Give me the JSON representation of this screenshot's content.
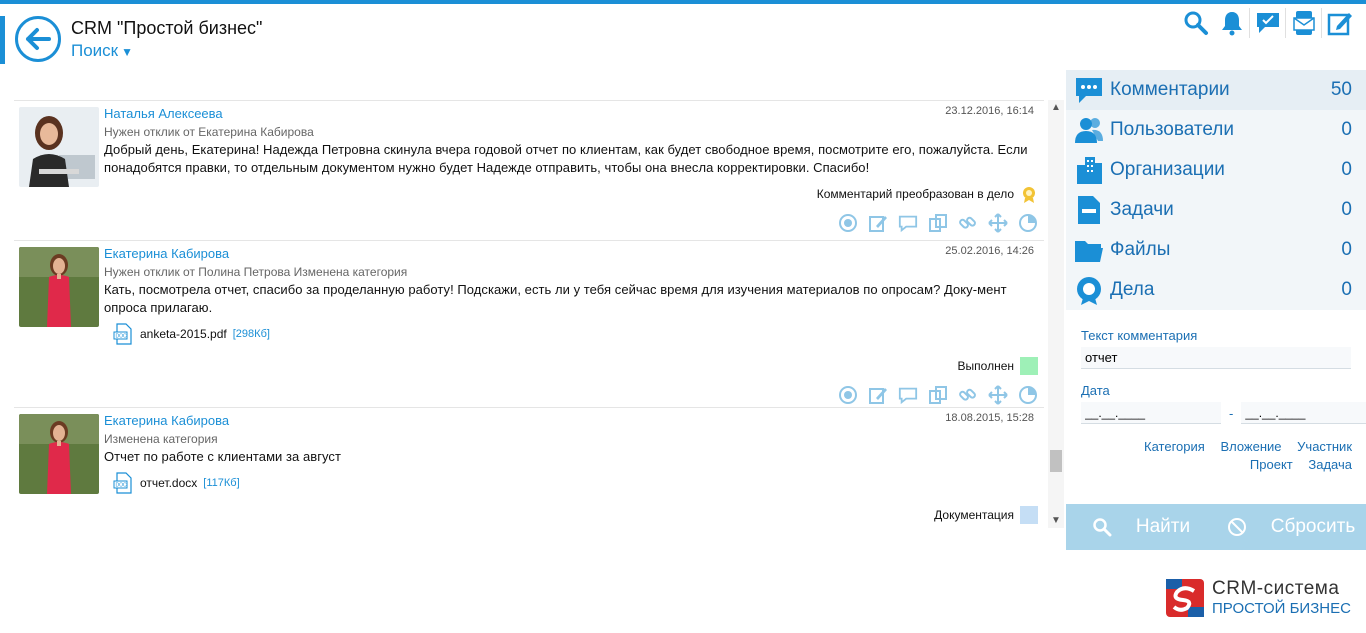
{
  "header": {
    "title": "CRM \"Простой бизнес\"",
    "search_label": "Поиск",
    "toolbar": [
      "search-icon",
      "bell-icon",
      "chat-icon",
      "envelope-phone-icon",
      "edit-icon"
    ]
  },
  "posts": [
    {
      "author": "Наталья Алексеева",
      "date": "23.12.2016, 16:14",
      "sub": "Нужен отклик от Екатерина Кабирова",
      "text": "Добрый день, Екатерина! Надежда Петровна скинула вчера годовой отчет по клиентам, как будет свободное время, посмотрите его, пожалуйста. Если понадобятся правки, то отдельным документом нужно будет Надежде отправить, чтобы она внесла корректировки. Спасибо!",
      "status": "Комментарий преобразован в дело"
    },
    {
      "author": "Екатерина Кабирова",
      "date": "25.02.2016, 14:26",
      "sub": "Нужен отклик от Полина Петрова Изменена категория",
      "text": "Кать, посмотрела отчет, спасибо за проделанную работу! Подскажи, есть ли у тебя сейчас время для изучения материалов по опросам? Доку-мент опроса прилагаю.",
      "file": "anketa-2015.pdf",
      "filesize": "[298Кб]",
      "status": "Выполнен",
      "status_color": "#9ef0b7"
    },
    {
      "author": "Екатерина Кабирова",
      "date": "18.08.2015, 15:28",
      "sub": "Изменена категория",
      "text": "Отчет по работе с клиентами за август",
      "file": "отчет.docx",
      "filesize": "[117Кб]",
      "status": "Документация",
      "status_color": "#c5def5"
    }
  ],
  "sidebar": {
    "categories": [
      {
        "label": "Комментарии",
        "count": "50",
        "icon": "comments-icon"
      },
      {
        "label": "Пользователи",
        "count": "0",
        "icon": "users-icon"
      },
      {
        "label": "Организации",
        "count": "0",
        "icon": "buildings-icon"
      },
      {
        "label": "Задачи",
        "count": "0",
        "icon": "tasks-icon"
      },
      {
        "label": "Файлы",
        "count": "0",
        "icon": "folder-icon"
      },
      {
        "label": "Дела",
        "count": "0",
        "icon": "badge-icon"
      }
    ],
    "comment_label": "Текст комментария",
    "comment_value": "отчет",
    "date_label": "Дата",
    "date_from": "__.__.____",
    "date_to": "__.__.____",
    "date_dash": "-",
    "links_row1": [
      "Категория",
      "Вложение",
      "Участник"
    ],
    "links_row2": [
      "Проект",
      "Задача"
    ],
    "find_label": "Найти",
    "reset_label": "Сбросить"
  },
  "brand": {
    "line1": "CRM-система",
    "line2": "ПРОСТОЙ БИЗНЕС"
  },
  "colors": {
    "accent": "#1b8fd6",
    "panel_button": "#a9d4ea"
  }
}
